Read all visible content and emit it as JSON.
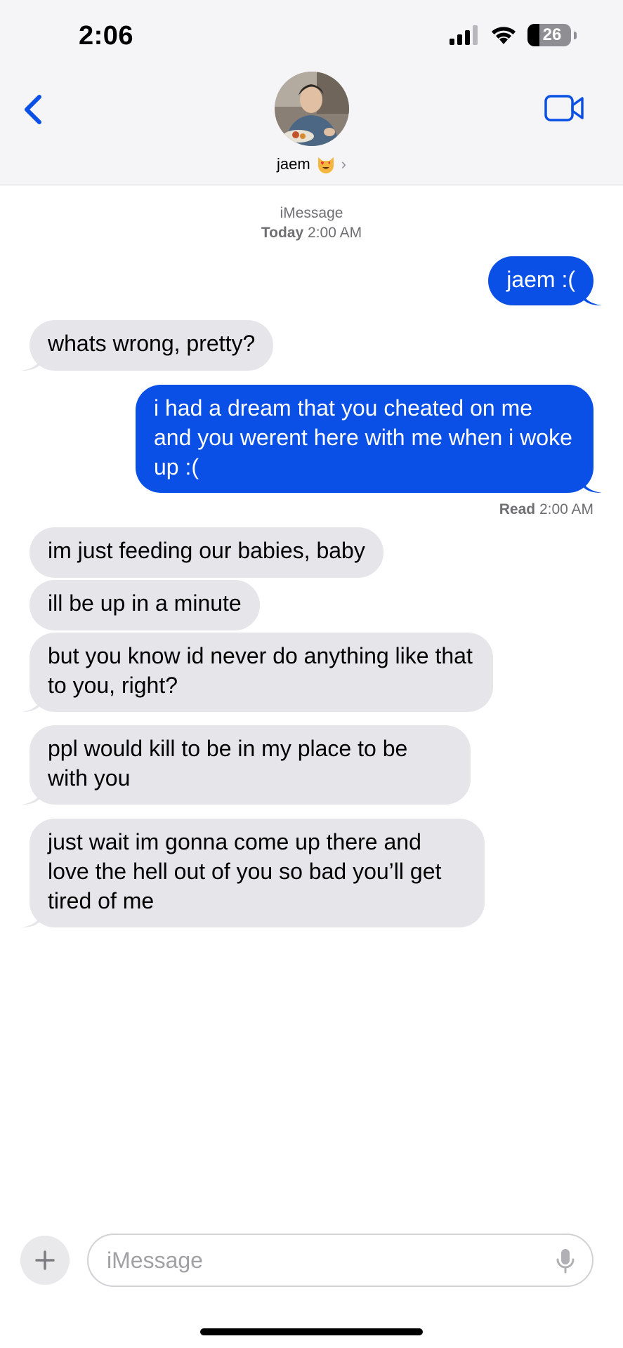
{
  "status_bar": {
    "time": "2:06",
    "battery_level": "26",
    "icons": [
      "signal-icon",
      "wifi-icon",
      "battery-icon"
    ]
  },
  "header": {
    "contact_name": "jaem",
    "emoji": "heart-eyes-cat-emoji",
    "chevron": "›",
    "icons": [
      "back-chevron-icon",
      "video-camera-icon"
    ],
    "accent_color": "#0a50e6"
  },
  "thread": {
    "service": "iMessage",
    "date_label": "Today",
    "date_time": "2:00 AM",
    "messages": [
      {
        "from": "me",
        "text": "jaem :("
      },
      {
        "from": "them",
        "text": "whats wrong, pretty?"
      },
      {
        "from": "me",
        "text": "i had a dream that you cheated on me and you werent here with me when i woke up :("
      },
      {
        "from": "them",
        "text": "im just feeding our babies, baby"
      },
      {
        "from": "them",
        "text": "ill be up in a minute"
      },
      {
        "from": "them",
        "text": "but you know id never do anything like that to you, right?"
      },
      {
        "from": "them",
        "text": "ppl would kill to be in my place to be with you"
      },
      {
        "from": "them",
        "text": "just wait im gonna come up there and love the hell out of you so bad you’ll get tired of me"
      }
    ],
    "read_receipt": {
      "label": "Read",
      "time": "2:00 AM"
    }
  },
  "composer": {
    "placeholder": "iMessage",
    "value": "",
    "icons": [
      "plus-icon",
      "microphone-icon"
    ]
  },
  "colors": {
    "sent_bubble": "#0a50e6",
    "received_bubble": "#e5e5ea",
    "header_background": "#f5f5f7"
  }
}
